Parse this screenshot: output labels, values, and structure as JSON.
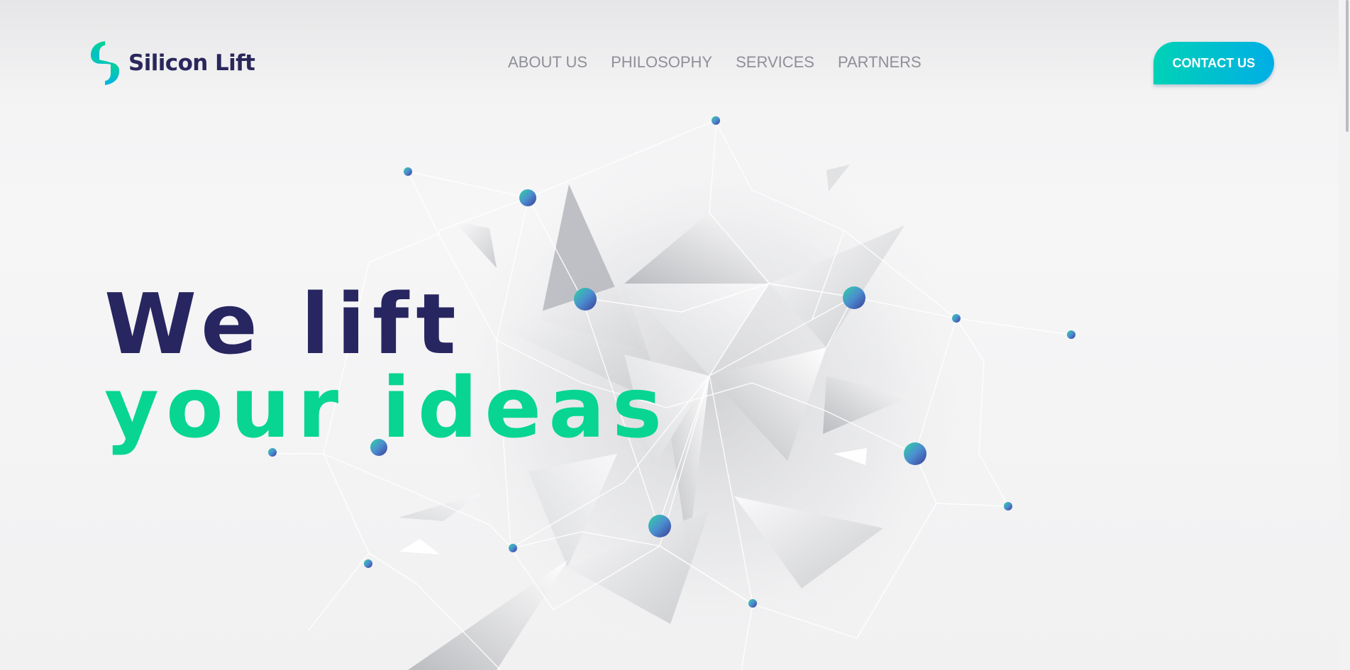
{
  "brand": {
    "name": "Silicon Lift",
    "accent": "#07d591",
    "dark": "#282660"
  },
  "nav": {
    "items": [
      "ABOUT US",
      "PHILOSOPHY",
      "SERVICES",
      "PARTNERS"
    ]
  },
  "cta": {
    "label": "CONTACT US"
  },
  "hero": {
    "line1": "We lift",
    "line2": "your ideas"
  },
  "icons": {
    "logo": "s-shaped-logo-icon",
    "art": "low-poly-crystal-network"
  }
}
